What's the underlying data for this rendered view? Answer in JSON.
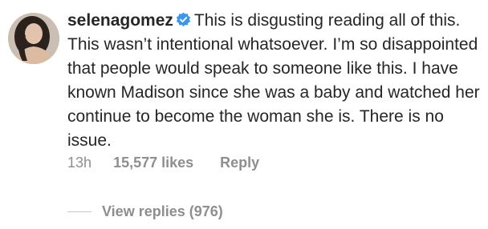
{
  "comment": {
    "username": "selenagomez",
    "verified_icon": "verified-badge-icon",
    "text": "This is disgusting reading all of this. This wasn’t intentional whatsoever. I’m so disappointed that people would speak to someone like this. I have known Madison since she was a baby and watched her continue to become the woman she is. There is no issue.",
    "time": "13h",
    "likes": "15,577 likes",
    "reply_label": "Reply",
    "view_replies_label": "View replies (976)"
  },
  "colors": {
    "text": "#262626",
    "secondary": "#8e8e8e",
    "verified_blue": "#3897f0",
    "divider": "#c7c7c7"
  }
}
